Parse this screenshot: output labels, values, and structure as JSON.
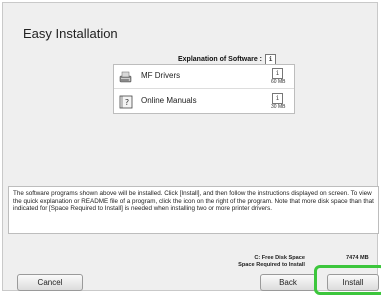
{
  "dialog": {
    "title": "Easy Installation"
  },
  "software_header": {
    "label": "Explanation of Software :",
    "icon": "info-icon"
  },
  "software_list": [
    {
      "name": "MF Drivers",
      "size": "60 MB",
      "icon": "printer-driver-icon"
    },
    {
      "name": "Online Manuals",
      "size": "30 MB",
      "icon": "manual-book-icon"
    }
  ],
  "description": "The software programs shown above will be installed. Click [Install], and then follow the instructions displayed on screen. To view the quick explanation or README file of a program, click the icon on the right of the program. Note that more disk space than that indicated for [Space Required to Install] is needed when installing two or more printer drivers.",
  "disk": {
    "free_label": "C: Free Disk Space",
    "free_value": "7474 MB",
    "required_label": "Space Required to Install"
  },
  "buttons": {
    "cancel": "Cancel",
    "back": "Back",
    "install": "Install"
  },
  "colors": {
    "highlight": "#3cc63c",
    "panel_bg": "#efefef"
  }
}
